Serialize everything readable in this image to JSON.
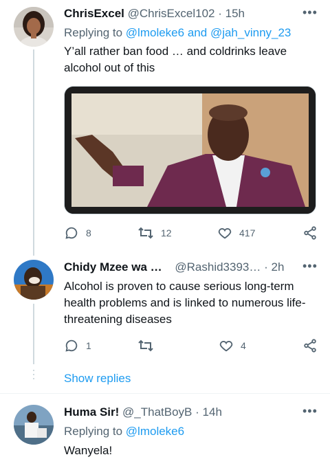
{
  "tweets": [
    {
      "display_name": "ChrisExcel",
      "handle": "@ChrisExcel102",
      "separator": "·",
      "time": "15h",
      "replying_prefix": "Replying to",
      "replying_to": [
        "@lmoleke6",
        "@jah_vinny_23"
      ],
      "replying_joiner": "and",
      "text": "Y’all rather ban food … and coldrinks leave alcohol out of this",
      "replies": "8",
      "retweets": "12",
      "likes": "417",
      "has_media": true
    },
    {
      "display_name": "Chidy Mzee wa …",
      "handle": "@Rashid3393…",
      "separator": "·",
      "time": "2h",
      "text": "Alcohol is proven to cause serious long-term health problems and is linked to numerous life-threatening diseases",
      "replies": "1",
      "retweets": "",
      "likes": "4"
    },
    {
      "display_name": "Huma Sir!",
      "handle": "@_ThatBoyB",
      "separator": "·",
      "time": "14h",
      "replying_prefix": "Replying to",
      "replying_to": [
        "@lmoleke6"
      ],
      "text": "Wanyela!"
    }
  ],
  "show_replies_label": "Show replies",
  "colors": {
    "accent": "#1d9bf0",
    "muted": "#536471",
    "text": "#0f1419",
    "line": "#cfd9de"
  },
  "icons": [
    "reply-icon",
    "retweet-icon",
    "like-icon",
    "share-icon",
    "more-icon"
  ]
}
